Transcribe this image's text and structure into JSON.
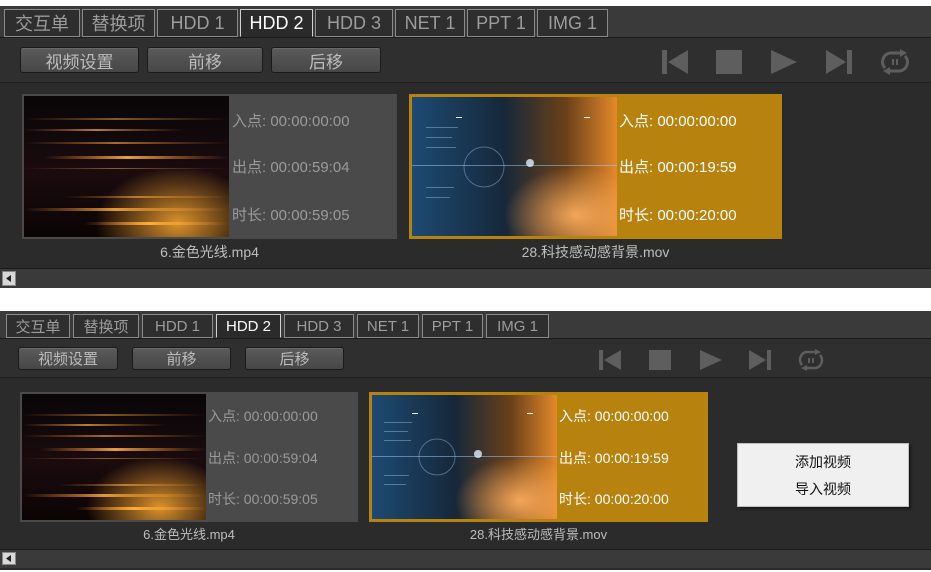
{
  "tabs": [
    "交互单",
    "替换项",
    "HDD 1",
    "HDD 2",
    "HDD 3",
    "NET 1",
    "PPT 1",
    "IMG 1"
  ],
  "active_tab": "HDD 2",
  "toolbar": {
    "video_settings": "视频设置",
    "move_forward": "前移",
    "move_back": "后移"
  },
  "controls": [
    "skip-previous-icon",
    "stop-icon",
    "play-icon",
    "skip-next-icon",
    "loop-icon"
  ],
  "clips": [
    {
      "in_label": "入点:",
      "in_time": "00:00:00:00",
      "out_label": "出点:",
      "out_time": "00:00:59:04",
      "dur_label": "时长:",
      "dur_time": "00:00:59:05",
      "filename": "6.金色光线.mp4",
      "selected": false
    },
    {
      "in_label": "入点:",
      "in_time": "00:00:00:00",
      "out_label": "出点:",
      "out_time": "00:00:19:59",
      "dur_label": "时长:",
      "dur_time": "00:00:20:00",
      "filename": "28.科技感动感背景.mov",
      "selected": true
    }
  ],
  "context_menu": {
    "add_video": "添加视频",
    "import_video": "导入视频"
  },
  "colors": {
    "panel_bg": "#2b2b2b",
    "selected_clip": "#b8820f",
    "unselected_clip": "#4a4a4a"
  }
}
